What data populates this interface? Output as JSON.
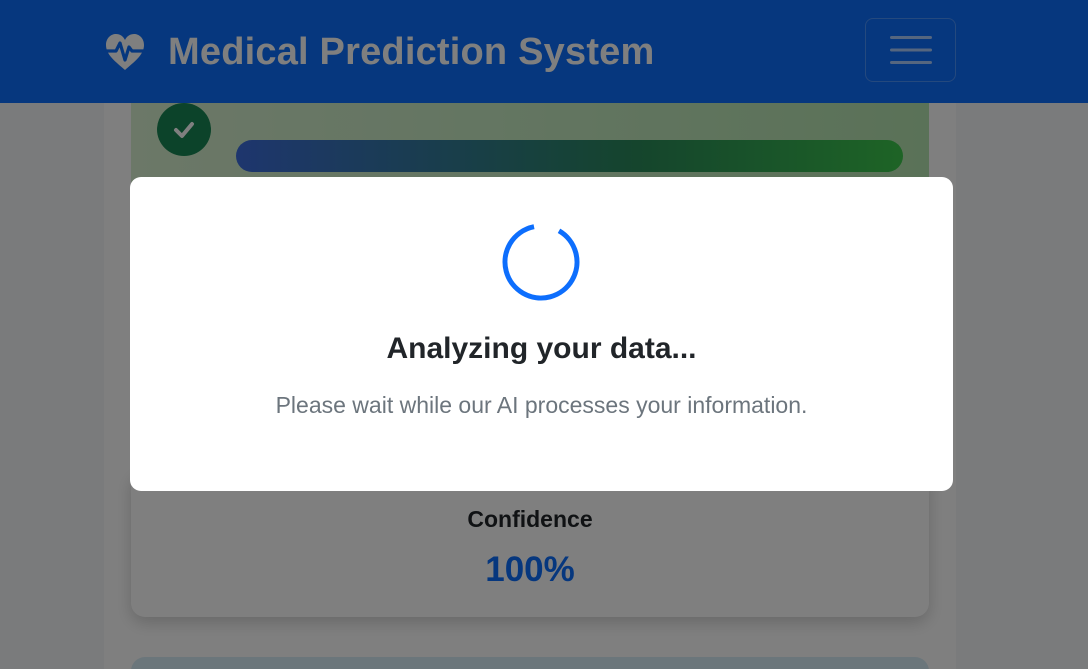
{
  "navbar": {
    "brand_icon": "heartbeat-icon",
    "brand_title": "Medical Prediction System",
    "menu_icon": "hamburger-menu-icon",
    "background_color": "#0d6efd"
  },
  "result": {
    "status_icon": "check-icon",
    "status_color": "#198754"
  },
  "confidence": {
    "label": "Confidence",
    "value": "100%",
    "value_color": "#0d6efd"
  },
  "loading_modal": {
    "spinner_icon": "loading-spinner-icon",
    "title": "Analyzing your data...",
    "message": "Please wait while our AI processes your information."
  }
}
